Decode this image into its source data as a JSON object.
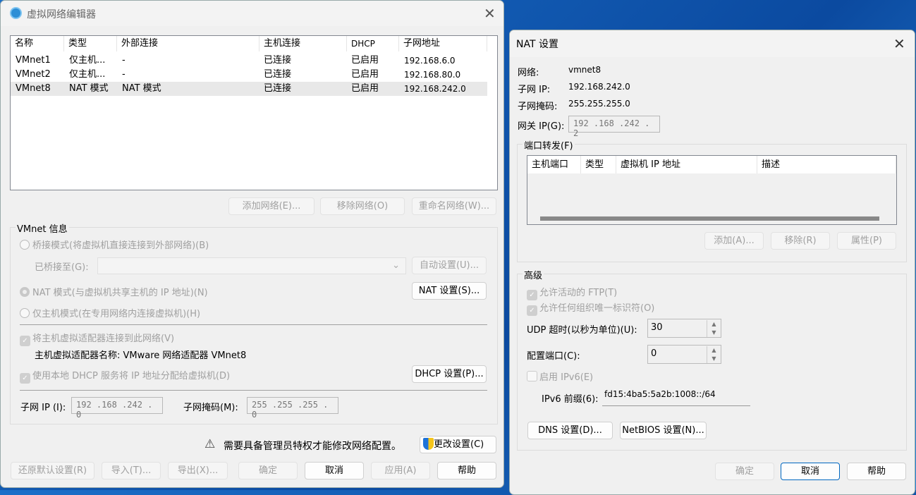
{
  "editor": {
    "title": "虚拟网络编辑器",
    "columns": [
      "名称",
      "类型",
      "外部连接",
      "主机连接",
      "DHCP",
      "子网地址"
    ],
    "rows": [
      [
        "VMnet1",
        "仅主机...",
        "-",
        "已连接",
        "已启用",
        "192.168.6.0"
      ],
      [
        "VMnet2",
        "仅主机...",
        "-",
        "已连接",
        "已启用",
        "192.168.80.0"
      ],
      [
        "VMnet8",
        "NAT 模式",
        "NAT 模式",
        "已连接",
        "已启用",
        "192.168.242.0"
      ]
    ],
    "add_network": "添加网络(E)...",
    "remove_network": "移除网络(O)",
    "rename_network": "重命名网络(W)...",
    "group": "VMnet 信息",
    "bridged": "桥接模式(将虚拟机直接连接到外部网络)(B)",
    "bridged_to": "已桥接至(G):",
    "auto_settings": "自动设置(U)...",
    "nat": "NAT 模式(与虚拟机共享主机的 IP 地址)(N)",
    "nat_settings": "NAT 设置(S)...",
    "host_only": "仅主机模式(在专用网络内连接虚拟机)(H)",
    "connect_adapter": "将主机虚拟适配器连接到此网络(V)",
    "adapter_name": "主机虚拟适配器名称: VMware 网络适配器 VMnet8",
    "use_dhcp": "使用本地 DHCP 服务将 IP 地址分配给虚拟机(D)",
    "dhcp_settings": "DHCP 设置(P)...",
    "subnet_ip_label": "子网 IP (I):",
    "subnet_ip": "192 .168 .242 .  0",
    "subnet_mask_label": "子网掩码(M):",
    "subnet_mask": "255 .255 .255 .  0",
    "warning": "需要具备管理员特权才能修改网络配置。",
    "change_settings": "更改设置(C)",
    "buttons": {
      "restore": "还原默认设置(R)",
      "import": "导入(T)...",
      "export": "导出(X)...",
      "ok": "确定",
      "cancel": "取消",
      "apply": "应用(A)",
      "help": "帮助"
    }
  },
  "nat": {
    "title": "NAT 设置",
    "network_label": "网络:",
    "network": "vmnet8",
    "subnet_ip_label": "子网 IP:",
    "subnet_ip": "192.168.242.0",
    "subnet_mask_label": "子网掩码:",
    "subnet_mask": "255.255.255.0",
    "gateway_label": "网关 IP(G):",
    "gateway": "192 .168 .242 .  2",
    "port_forwarding": "端口转发(F)",
    "columns": [
      "主机端口",
      "类型",
      "虚拟机 IP 地址",
      "描述"
    ],
    "add": "添加(A)...",
    "remove": "移除(R)",
    "properties": "属性(P)",
    "advanced": "高级",
    "allow_ftp": "允许活动的 FTP(T)",
    "allow_oui": "允许任何组织唯一标识符(O)",
    "udp_label": "UDP 超时(以秒为单位)(U):",
    "udp": "30",
    "config_port_label": "配置端口(C):",
    "config_port": "0",
    "enable_ipv6": "启用 IPv6(E)",
    "ipv6_label": "IPv6 前缀(6):",
    "ipv6": "fd15:4ba5:5a2b:1008::/64",
    "dns": "DNS 设置(D)...",
    "netbios": "NetBIOS 设置(N)...",
    "ok": "确定",
    "cancel": "取消",
    "help": "帮助"
  }
}
